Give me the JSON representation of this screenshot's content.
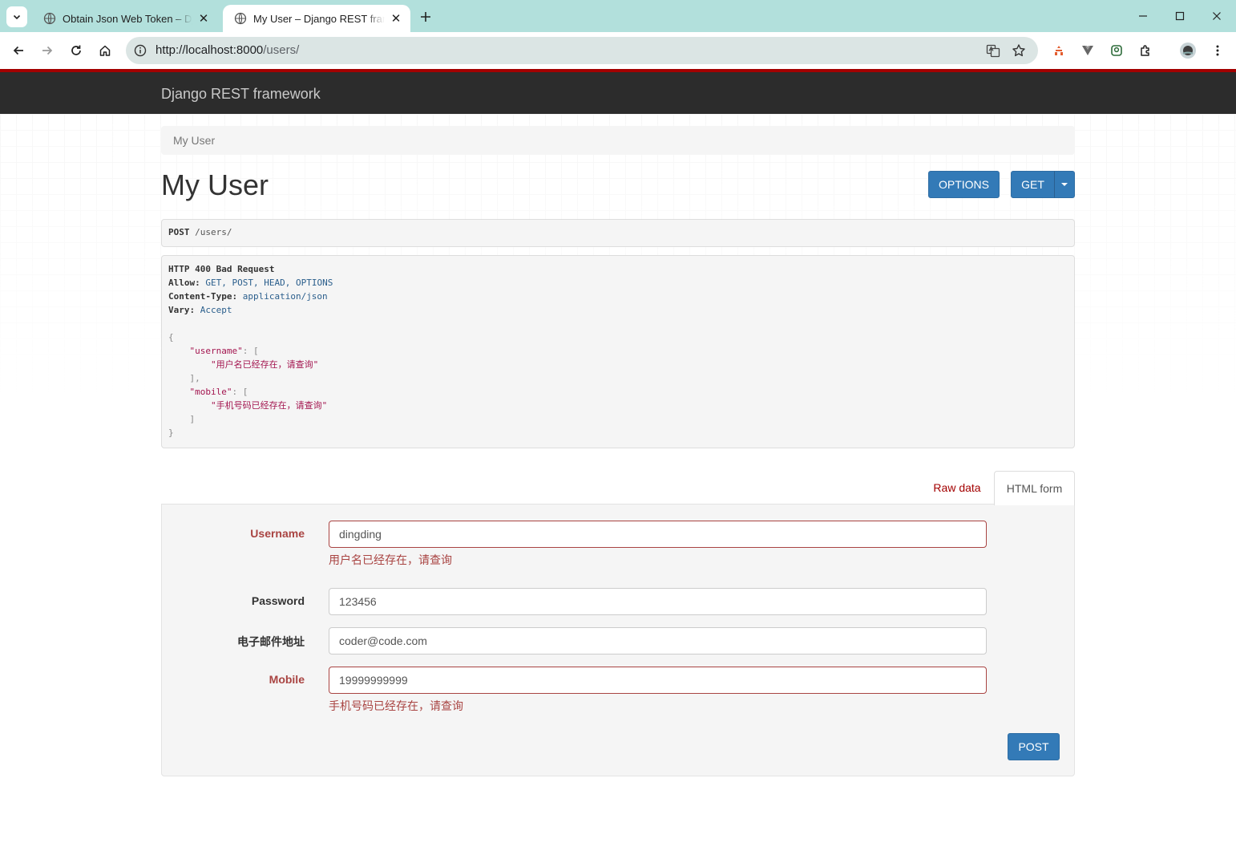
{
  "browser": {
    "tabs": [
      {
        "title": "Obtain Json Web Token – Django REST framework",
        "active": false
      },
      {
        "title": "My User – Django REST framework",
        "active": true
      }
    ],
    "url_host": "http://localhost:8000",
    "url_path": "/users/"
  },
  "page": {
    "brand": "Django REST framework",
    "breadcrumb": "My User",
    "title": "My User",
    "buttons": {
      "options": "OPTIONS",
      "get": "GET",
      "post": "POST"
    },
    "request": {
      "method": "POST",
      "path": "/users/"
    },
    "response": {
      "status_line": "HTTP 400 Bad Request",
      "headers": [
        {
          "key": "Allow:",
          "value": "GET, POST, HEAD, OPTIONS"
        },
        {
          "key": "Content-Type:",
          "value": "application/json"
        },
        {
          "key": "Vary:",
          "value": "Accept"
        }
      ],
      "body": {
        "username_key": "\"username\"",
        "username_msg": "\"用户名已经存在，请查询\"",
        "mobile_key": "\"mobile\"",
        "mobile_msg": "\"手机号码已经存在，请查询\""
      }
    },
    "form_tabs": {
      "raw": "Raw data",
      "html": "HTML form"
    },
    "form": {
      "username": {
        "label": "Username",
        "value": "dingding",
        "error": "用户名已经存在，请查询"
      },
      "password": {
        "label": "Password",
        "value": "123456"
      },
      "email": {
        "label": "电子邮件地址",
        "value": "coder@code.com"
      },
      "mobile": {
        "label": "Mobile",
        "value": "19999999999",
        "error": "手机号码已经存在，请查询"
      }
    }
  }
}
